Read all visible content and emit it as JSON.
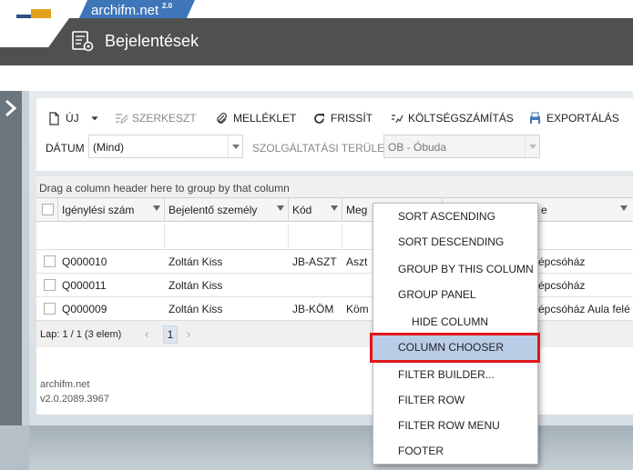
{
  "brand": {
    "name": "archifm.net",
    "version": "2.0"
  },
  "header": {
    "title": "Bejelentések"
  },
  "toolbar": {
    "new_label": "ÚJ",
    "edit_label": "SZERKESZT",
    "attachment_label": "MELLÉKLET",
    "refresh_label": "FRISSÍT",
    "cost_label": "KÖLTSÉGSZÁMÍTÁS",
    "export_label": "EXPORTÁLÁS"
  },
  "filters": {
    "date_label": "DÁTUM",
    "date_value": "(Mind)",
    "area_label": "SZOLGÁLTATÁSI TERÜLET",
    "area_value": "OB - Óbuda"
  },
  "grid": {
    "group_hint": "Drag a column header here to group by that column",
    "columns": [
      "Igénylési szám",
      "Bejelentő személy",
      "Kód",
      "Meg",
      "e"
    ],
    "rows": [
      {
        "id": "Q000010",
        "person": "Zoltán Kiss",
        "code": "JB-ASZT",
        "desc": "Aszt",
        "location": "épcsóház"
      },
      {
        "id": "Q000011",
        "person": "Zoltán Kiss",
        "code": "",
        "desc": "",
        "location": "épcsóház"
      },
      {
        "id": "Q000009",
        "person": "Zoltán Kiss",
        "code": "JB-KÖM",
        "desc": "Köm",
        "location": "épcsóház Aula felé"
      }
    ],
    "pager": {
      "info": "Lap: 1 / 1 (3 elem)",
      "page": "1",
      "prev": "‹",
      "next": "›"
    }
  },
  "footer": {
    "name": "archifm.net",
    "version": "v2.0.2089.3967"
  },
  "context_menu": {
    "items": [
      {
        "label": "SORT ASCENDING"
      },
      {
        "label": "SORT DESCENDING"
      },
      {
        "label": "GROUP BY THIS COLUMN"
      },
      {
        "label": "GROUP PANEL"
      },
      {
        "label": "HIDE COLUMN"
      },
      {
        "label": "COLUMN CHOOSER"
      },
      {
        "label": "FILTER BUILDER..."
      },
      {
        "label": "FILTER ROW"
      },
      {
        "label": "FILTER ROW MENU"
      },
      {
        "label": "FOOTER"
      }
    ]
  },
  "colors": {
    "brand_blue": "#3e76b9",
    "header_gray": "#505050",
    "highlight": "#b9cde7",
    "callout_red": "#e0161b"
  },
  "icons": [
    "logo-icon",
    "report-gear-icon",
    "new-doc-icon",
    "edit-icon",
    "paperclip-icon",
    "refresh-icon",
    "calculator-icon",
    "export-icon",
    "filter-funnel-icon",
    "sidebar-chevron-icon"
  ]
}
